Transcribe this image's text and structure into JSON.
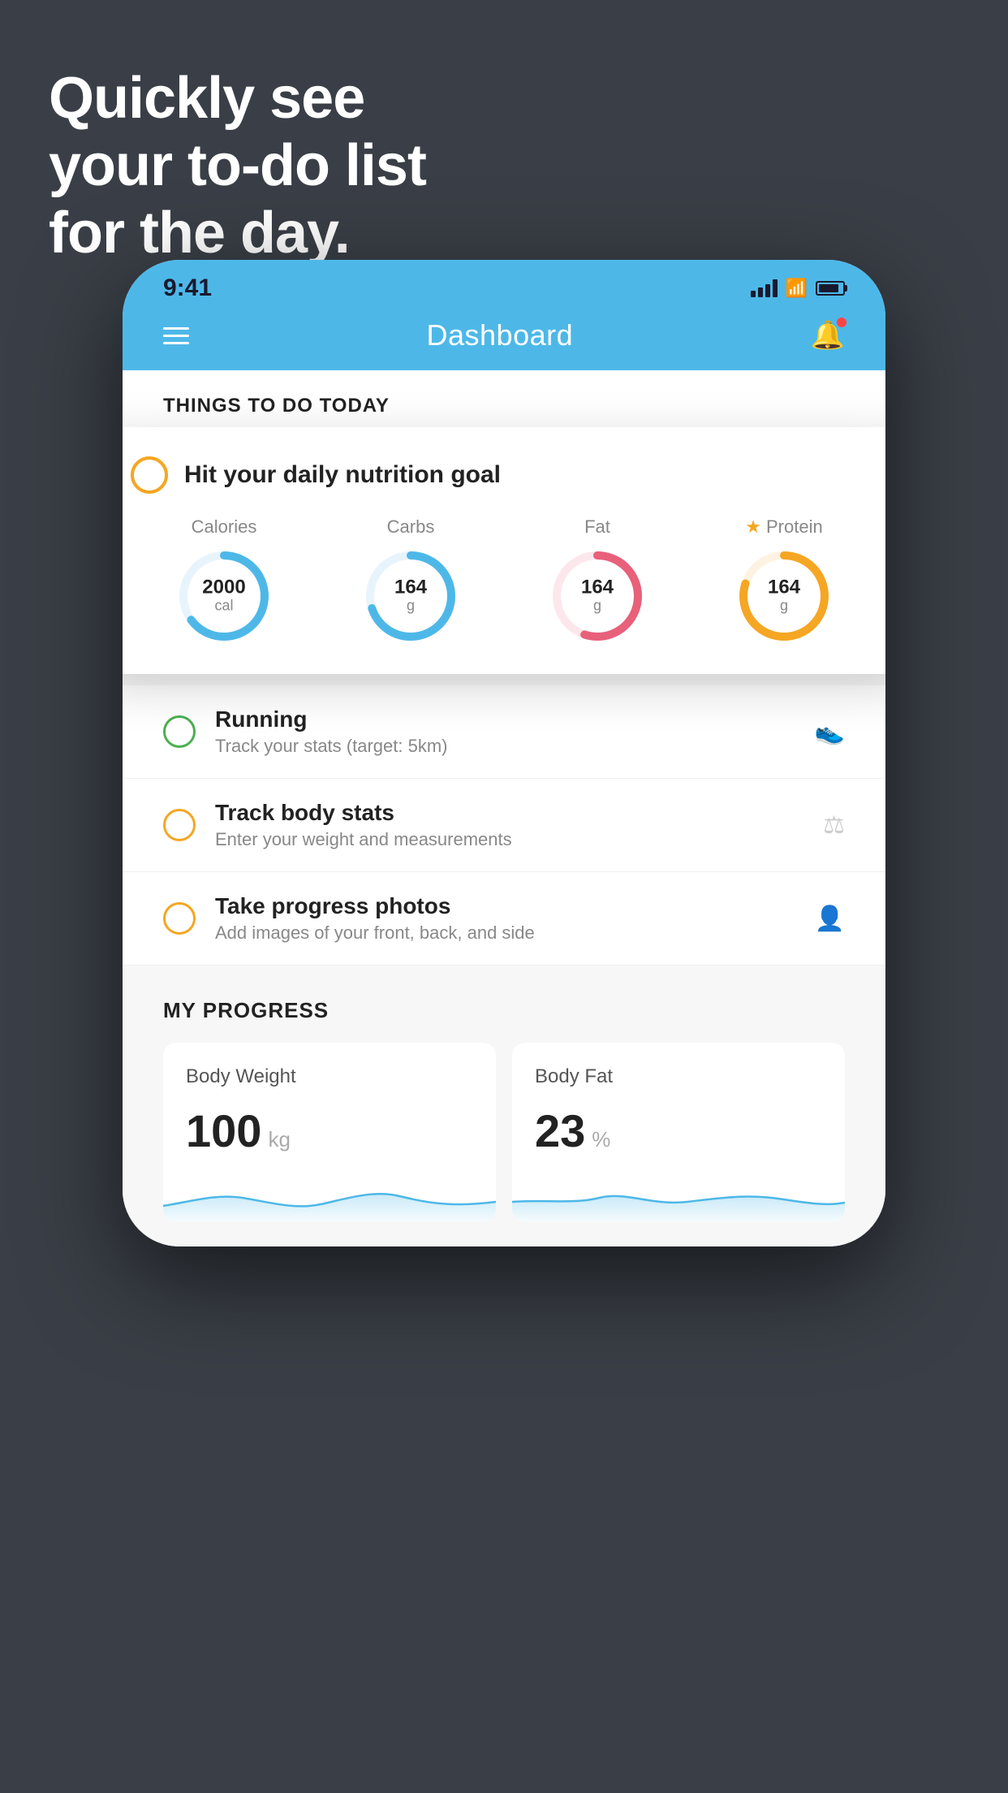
{
  "hero": {
    "line1": "Quickly see",
    "line2": "your to-do list",
    "line3": "for the day."
  },
  "status_bar": {
    "time": "9:41"
  },
  "header": {
    "title": "Dashboard"
  },
  "things_section": {
    "label": "THINGS TO DO TODAY"
  },
  "nutrition_card": {
    "title": "Hit your daily nutrition goal",
    "stats": [
      {
        "label": "Calories",
        "value": "2000",
        "unit": "cal",
        "color": "#4db8e8",
        "pct": 65,
        "star": false
      },
      {
        "label": "Carbs",
        "value": "164",
        "unit": "g",
        "color": "#4db8e8",
        "pct": 70,
        "star": false
      },
      {
        "label": "Fat",
        "value": "164",
        "unit": "g",
        "color": "#e8607a",
        "pct": 55,
        "star": false
      },
      {
        "label": "Protein",
        "value": "164",
        "unit": "g",
        "color": "#f5a623",
        "pct": 80,
        "star": true
      }
    ]
  },
  "todo_items": [
    {
      "title": "Running",
      "subtitle": "Track your stats (target: 5km)",
      "circle_color": "green",
      "completed": false,
      "icon": "shoe"
    },
    {
      "title": "Track body stats",
      "subtitle": "Enter your weight and measurements",
      "circle_color": "yellow",
      "completed": false,
      "icon": "scale"
    },
    {
      "title": "Take progress photos",
      "subtitle": "Add images of your front, back, and side",
      "circle_color": "yellow",
      "completed": false,
      "icon": "photo"
    }
  ],
  "progress_section": {
    "title": "MY PROGRESS",
    "cards": [
      {
        "title": "Body Weight",
        "value": "100",
        "unit": "kg"
      },
      {
        "title": "Body Fat",
        "value": "23",
        "unit": "%"
      }
    ]
  }
}
